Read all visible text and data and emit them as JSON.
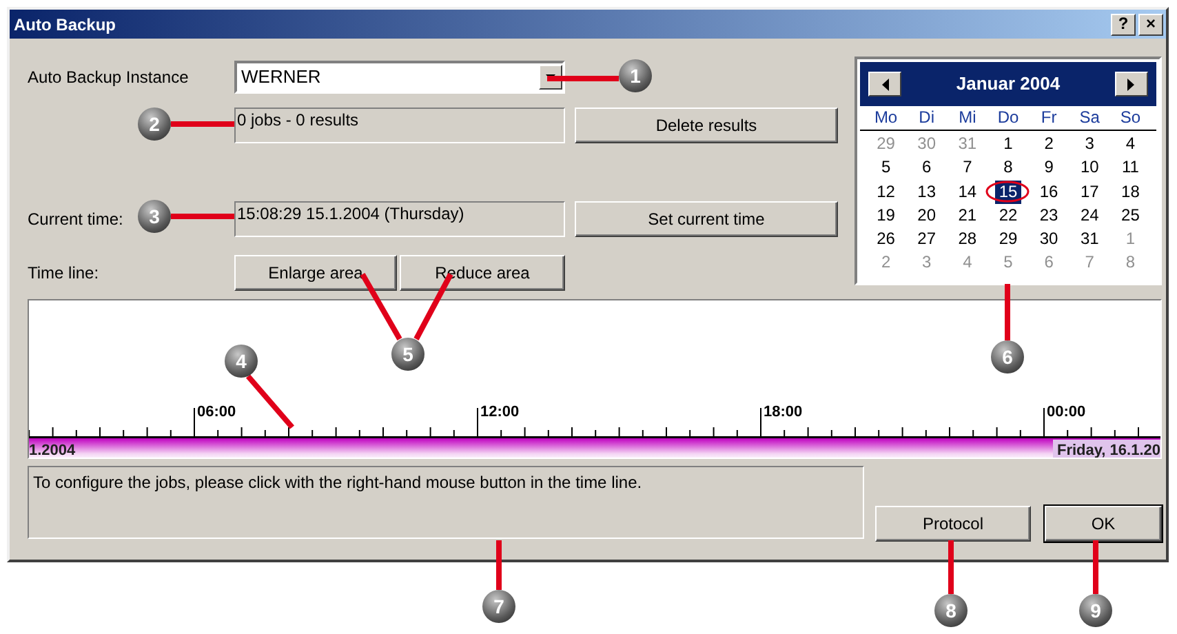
{
  "window": {
    "title": "Auto Backup",
    "help_button": "?",
    "close_button": "×"
  },
  "instance": {
    "label": "Auto Backup Instance",
    "value": "WERNER"
  },
  "jobs_field": {
    "value": "0 jobs - 0 results"
  },
  "delete_button": "Delete results",
  "current_time": {
    "label": "Current time:",
    "value": "15:08:29 15.1.2004 (Thursday)"
  },
  "set_time_button": "Set current time",
  "timeline": {
    "label": "Time line:",
    "enlarge_button": "Enlarge area",
    "reduce_button": "Reduce area",
    "hour_labels": [
      "06:00",
      "12:00",
      "18:00",
      "00:00"
    ],
    "start_label": "1.2004",
    "end_label": "Friday, 16.1.20"
  },
  "calendar": {
    "title": "Januar 2004",
    "weekdays": [
      "Mo",
      "Di",
      "Mi",
      "Do",
      "Fr",
      "Sa",
      "So"
    ],
    "days": [
      {
        "day": "29",
        "other_month": true,
        "selected": false
      },
      {
        "day": "30",
        "other_month": true,
        "selected": false
      },
      {
        "day": "31",
        "other_month": true,
        "selected": false
      },
      {
        "day": "1",
        "other_month": false,
        "selected": false
      },
      {
        "day": "2",
        "other_month": false,
        "selected": false
      },
      {
        "day": "3",
        "other_month": false,
        "selected": false
      },
      {
        "day": "4",
        "other_month": false,
        "selected": false
      },
      {
        "day": "5",
        "other_month": false,
        "selected": false
      },
      {
        "day": "6",
        "other_month": false,
        "selected": false
      },
      {
        "day": "7",
        "other_month": false,
        "selected": false
      },
      {
        "day": "8",
        "other_month": false,
        "selected": false
      },
      {
        "day": "9",
        "other_month": false,
        "selected": false
      },
      {
        "day": "10",
        "other_month": false,
        "selected": false
      },
      {
        "day": "11",
        "other_month": false,
        "selected": false
      },
      {
        "day": "12",
        "other_month": false,
        "selected": false
      },
      {
        "day": "13",
        "other_month": false,
        "selected": false
      },
      {
        "day": "14",
        "other_month": false,
        "selected": false
      },
      {
        "day": "15",
        "other_month": false,
        "selected": true
      },
      {
        "day": "16",
        "other_month": false,
        "selected": false
      },
      {
        "day": "17",
        "other_month": false,
        "selected": false
      },
      {
        "day": "18",
        "other_month": false,
        "selected": false
      },
      {
        "day": "19",
        "other_month": false,
        "selected": false
      },
      {
        "day": "20",
        "other_month": false,
        "selected": false
      },
      {
        "day": "21",
        "other_month": false,
        "selected": false
      },
      {
        "day": "22",
        "other_month": false,
        "selected": false
      },
      {
        "day": "23",
        "other_month": false,
        "selected": false
      },
      {
        "day": "24",
        "other_month": false,
        "selected": false
      },
      {
        "day": "25",
        "other_month": false,
        "selected": false
      },
      {
        "day": "26",
        "other_month": false,
        "selected": false
      },
      {
        "day": "27",
        "other_month": false,
        "selected": false
      },
      {
        "day": "28",
        "other_month": false,
        "selected": false
      },
      {
        "day": "29",
        "other_month": false,
        "selected": false
      },
      {
        "day": "30",
        "other_month": false,
        "selected": false
      },
      {
        "day": "31",
        "other_month": false,
        "selected": false
      },
      {
        "day": "1",
        "other_month": true,
        "selected": false
      },
      {
        "day": "2",
        "other_month": true,
        "selected": false
      },
      {
        "day": "3",
        "other_month": true,
        "selected": false
      },
      {
        "day": "4",
        "other_month": true,
        "selected": false
      },
      {
        "day": "5",
        "other_month": true,
        "selected": false
      },
      {
        "day": "6",
        "other_month": true,
        "selected": false
      },
      {
        "day": "7",
        "other_month": true,
        "selected": false
      },
      {
        "day": "8",
        "other_month": true,
        "selected": false
      }
    ]
  },
  "status_text": "To configure the jobs, please click with the right-hand mouse button in the time line.",
  "protocol_button": "Protocol",
  "ok_button": "OK",
  "callouts": [
    "1",
    "2",
    "3",
    "4",
    "5",
    "6",
    "7",
    "8",
    "9"
  ]
}
